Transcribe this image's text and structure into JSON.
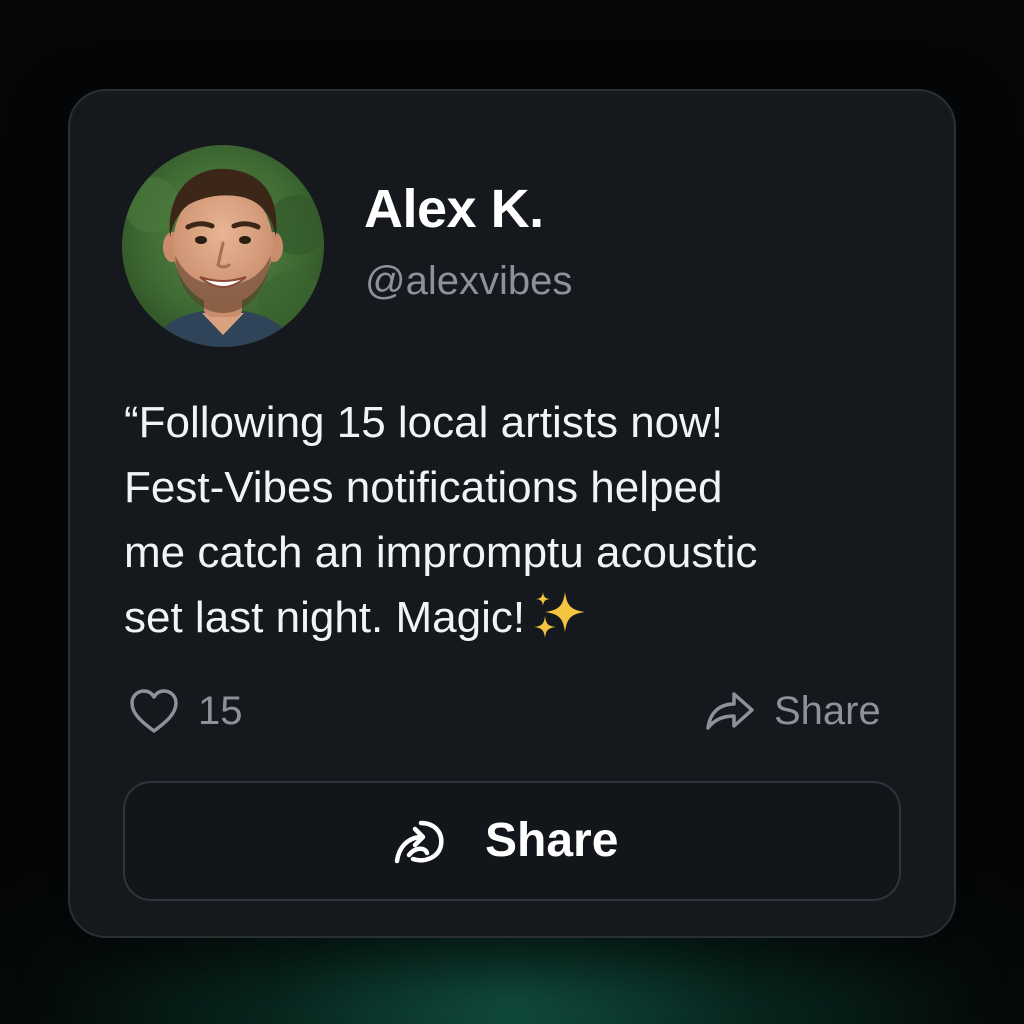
{
  "user": {
    "name": "Alex K.",
    "handle": "@alexvibes",
    "avatar_alt": "avatar-photo"
  },
  "post": {
    "lines": [
      "“Following 15 local artists now!",
      "Fest-Vibes notifications helped",
      "me catch an impromptu acoustic",
      "set last night. Magic!"
    ],
    "emoji_icon": "sparkles-icon"
  },
  "actions": {
    "like_count": "15",
    "like_icon": "heart-outline-icon",
    "share_label": "Share",
    "share_icon": "share-arrow-icon"
  },
  "share_button": {
    "label": "Share",
    "icon": "share-swirl-icon"
  },
  "colors": {
    "card_bg": "#15181c",
    "card_border": "#2a2f34",
    "muted_text": "#8b929b",
    "primary_text": "#ffffff",
    "sparkle": "#f5c542"
  }
}
